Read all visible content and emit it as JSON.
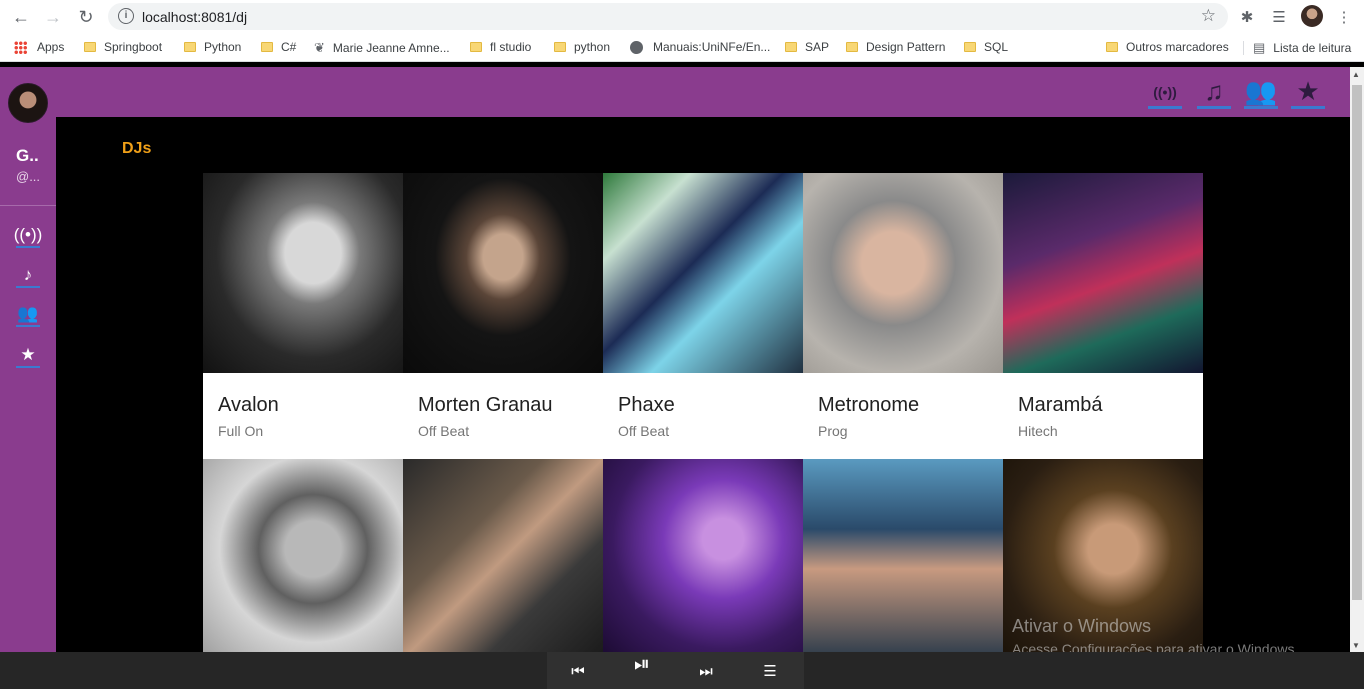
{
  "browser": {
    "url": "localhost:8081/dj",
    "bookmarks": [
      {
        "label": "Apps",
        "icon": "apps-grid-icon"
      },
      {
        "label": "Springboot",
        "icon": "folder-icon"
      },
      {
        "label": "Python",
        "icon": "folder-icon"
      },
      {
        "label": "C#",
        "icon": "folder-icon"
      },
      {
        "label": "Marie Jeanne Amne...",
        "icon": "leaf-icon"
      },
      {
        "label": "fl studio",
        "icon": "folder-icon"
      },
      {
        "label": "python",
        "icon": "folder-icon"
      },
      {
        "label": "Manuais:UniNFe/En...",
        "icon": "globe-icon"
      },
      {
        "label": "SAP",
        "icon": "folder-icon"
      },
      {
        "label": "Design Pattern",
        "icon": "folder-icon"
      },
      {
        "label": "SQL",
        "icon": "folder-icon"
      }
    ],
    "other_bookmarks": "Outros marcadores",
    "reading_list": "Lista de leitura"
  },
  "sidebar": {
    "user_name": "G..",
    "user_handle": "@...",
    "nav_icons": [
      "broadcast-icon",
      "music-artist-icon",
      "users-icon",
      "star-icon"
    ]
  },
  "appbar": {
    "icons": [
      "broadcast-icon",
      "music-artist-icon",
      "users-icon",
      "star-icon"
    ]
  },
  "page": {
    "title": "DJs",
    "cards": [
      {
        "name": "Avalon",
        "genre": "Full On"
      },
      {
        "name": "Morten Granau",
        "genre": "Off Beat"
      },
      {
        "name": "Phaxe",
        "genre": "Off Beat"
      },
      {
        "name": "Metronome",
        "genre": "Prog"
      },
      {
        "name": "Marambá",
        "genre": "Hitech"
      }
    ]
  },
  "watermark": {
    "title": "Ativar o Windows",
    "subtitle": "Acesse Configurações para ativar o Windows."
  },
  "colors": {
    "accent": "#8a3c8e",
    "title": "#f0a018",
    "underline": "#3a7ad0"
  }
}
